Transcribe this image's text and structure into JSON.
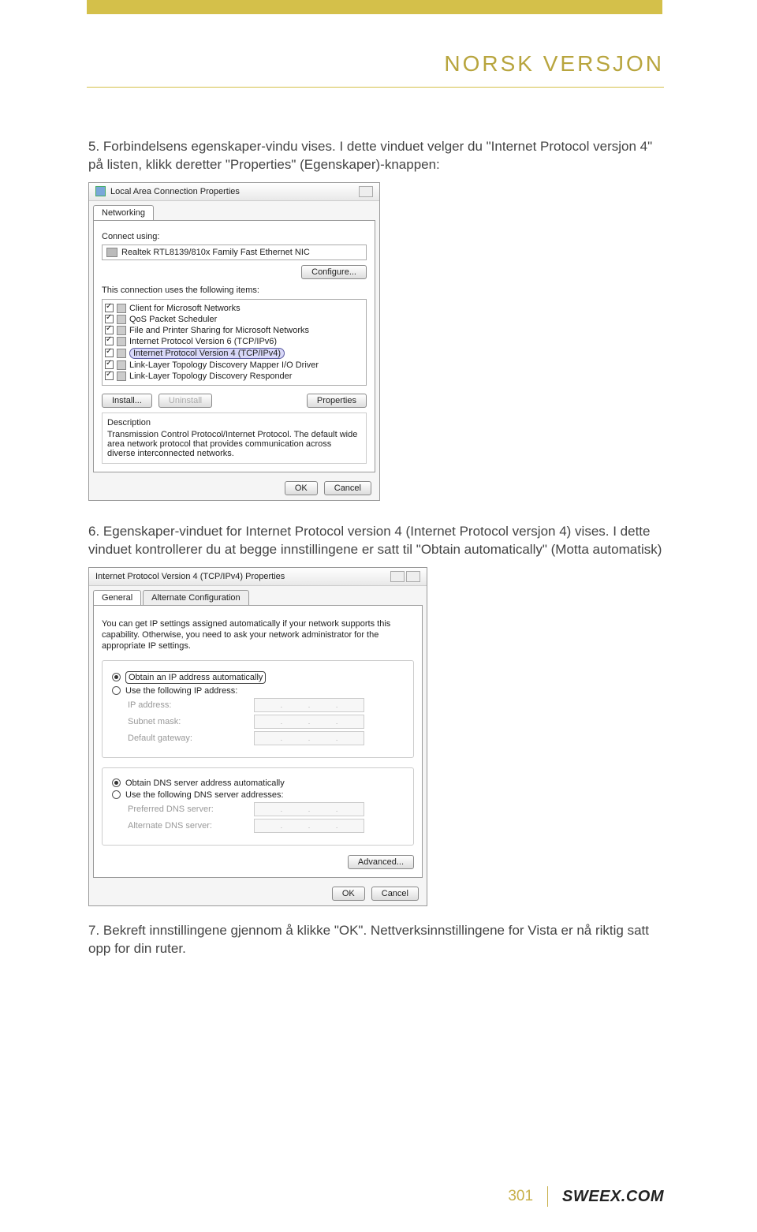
{
  "header": {
    "title": "NORSK VERSJON"
  },
  "step5": "5. Forbindelsens egenskaper-vindu vises. I dette vinduet velger du \"Internet Protocol versjon 4\" på listen, klikk deretter \"Properties\" (Egenskaper)-knappen:",
  "dlg1": {
    "title": "Local Area Connection Properties",
    "tab": "Networking",
    "connect_using": "Connect using:",
    "adapter": "Realtek RTL8139/810x Family Fast Ethernet NIC",
    "configure": "Configure...",
    "uses_items": "This connection uses the following items:",
    "items": [
      "Client for Microsoft Networks",
      "QoS Packet Scheduler",
      "File and Printer Sharing for Microsoft Networks",
      "Internet Protocol Version 6 (TCP/IPv6)",
      "Internet Protocol Version 4 (TCP/IPv4)",
      "Link-Layer Topology Discovery Mapper I/O Driver",
      "Link-Layer Topology Discovery Responder"
    ],
    "install": "Install...",
    "uninstall": "Uninstall",
    "properties": "Properties",
    "desc_label": "Description",
    "desc": "Transmission Control Protocol/Internet Protocol. The default wide area network protocol that provides communication across diverse interconnected networks.",
    "ok": "OK",
    "cancel": "Cancel"
  },
  "step6": "6. Egenskaper-vinduet for Internet Protocol version 4 (Internet Protocol versjon 4) vises. I dette vinduet kontrollerer du at begge innstillingene er satt til \"Obtain automatically\" (Motta automatisk)",
  "dlg2": {
    "title": "Internet Protocol Version 4 (TCP/IPv4) Properties",
    "tab_general": "General",
    "tab_alt": "Alternate Configuration",
    "intro": "You can get IP settings assigned automatically if your network supports this capability. Otherwise, you need to ask your network administrator for the appropriate IP settings.",
    "r_obtain_ip": "Obtain an IP address automatically",
    "r_use_ip": "Use the following IP address:",
    "ip": "IP address:",
    "subnet": "Subnet mask:",
    "gateway": "Default gateway:",
    "r_obtain_dns": "Obtain DNS server address automatically",
    "r_use_dns": "Use the following DNS server addresses:",
    "pref_dns": "Preferred DNS server:",
    "alt_dns": "Alternate DNS server:",
    "advanced": "Advanced...",
    "ok": "OK",
    "cancel": "Cancel"
  },
  "step7": "7. Bekreft innstillingene gjennom å klikke \"OK\". Nettverksinnstillingene for Vista er nå riktig satt opp for din ruter.",
  "footer": {
    "page": "301",
    "brand": "SWEEX.COM"
  }
}
